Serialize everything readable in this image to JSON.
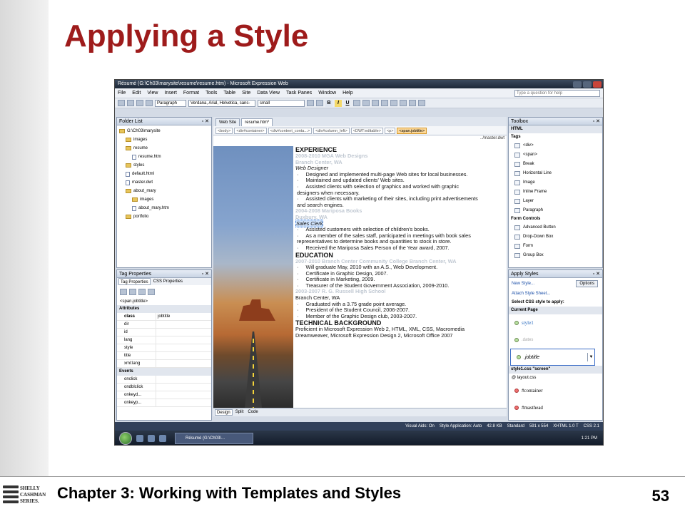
{
  "slide": {
    "title": "Applying a Style",
    "footer": "Chapter 3: Working with Templates and Styles",
    "page_number": "53",
    "logo_text": [
      "SHELLY",
      "CASHMAN",
      "SERIES."
    ]
  },
  "window": {
    "title": "Résumé (G:\\Ch03\\marysite\\resume\\resume.htm) - Microsoft Expression Web",
    "menu": [
      "File",
      "Edit",
      "View",
      "Insert",
      "Format",
      "Tools",
      "Table",
      "Site",
      "Data View",
      "Task Panes",
      "Window",
      "Help"
    ],
    "help_placeholder": "Type a question for help",
    "style_select": "Paragraph",
    "font_select": "Verdana, Arial, Helvetica, sans-",
    "size_select": "small"
  },
  "folder_list": {
    "title": "Folder List",
    "items": [
      {
        "label": "G:\\Ch03\\marysite",
        "type": "folder",
        "indent": 0
      },
      {
        "label": "images",
        "type": "folder",
        "indent": 1
      },
      {
        "label": "resume",
        "type": "folder",
        "indent": 1
      },
      {
        "label": "resume.htm",
        "type": "file",
        "indent": 2
      },
      {
        "label": "styles",
        "type": "folder",
        "indent": 1
      },
      {
        "label": "default.html",
        "type": "file",
        "indent": 1
      },
      {
        "label": "master.dwt",
        "type": "file",
        "indent": 1
      },
      {
        "label": "about_mary",
        "type": "folder",
        "indent": 1
      },
      {
        "label": "images",
        "type": "folder",
        "indent": 2
      },
      {
        "label": "about_mary.htm",
        "type": "file",
        "indent": 2
      },
      {
        "label": "portfolio",
        "type": "folder",
        "indent": 1
      }
    ]
  },
  "tag_properties": {
    "title": "Tag Properties",
    "tabs": [
      "Tag Properties",
      "CSS Properties"
    ],
    "tag": "<span.jobtitle>",
    "attributes_header": "Attributes",
    "attributes": [
      {
        "name": "class",
        "value": "jobtitle"
      },
      {
        "name": "dir",
        "value": ""
      },
      {
        "name": "id",
        "value": ""
      },
      {
        "name": "lang",
        "value": ""
      },
      {
        "name": "style",
        "value": ""
      },
      {
        "name": "title",
        "value": ""
      },
      {
        "name": "xml:lang",
        "value": ""
      }
    ],
    "events_header": "Events",
    "events": [
      "onclick",
      "ondblclick",
      "onkeyd...",
      "onkeyp..."
    ]
  },
  "editor": {
    "tabs": [
      "Web Site",
      "resume.htm*"
    ],
    "crumbs": [
      "<body>",
      "<div#container>",
      "<div#content_conta...>",
      "<div#column_left>",
      "<DWT:editable>",
      "<p>",
      "<span.jobtitle>"
    ],
    "master": "../master.dwt",
    "view_tabs": [
      "Design",
      "Split",
      "Code"
    ],
    "content": [
      {
        "cls": "h",
        "text": "EXPERIENCE"
      },
      {
        "cls": "hdr",
        "text": "2008-2010      MGA Web Designs"
      },
      {
        "cls": "hdr",
        "text": "Branch Center, WA"
      },
      {
        "cls": "it",
        "text": "Web Designer"
      },
      {
        "cls": "b",
        "text": "Designed and implemented multi-page Web sites for local businesses."
      },
      {
        "cls": "b",
        "text": "Maintained and updated clients' Web sites."
      },
      {
        "cls": "b",
        "text": "Assisted clients with selection of graphics and worked with graphic designers when necessary."
      },
      {
        "cls": "b",
        "text": "Assisted clients with marketing of their sites, including print advertisements and search engines."
      },
      {
        "cls": "hdr",
        "text": "2004-2008      Mariposa Books"
      },
      {
        "cls": "hdr",
        "text": "Duxbury, WA"
      },
      {
        "cls": "sel",
        "text": "Sales Clerk"
      },
      {
        "cls": "b",
        "text": "Assisted customers with selection of children's books."
      },
      {
        "cls": "b",
        "text": "As a member of the sales staff, participated in meetings with book sales representatives to determine books and quantities to stock in store."
      },
      {
        "cls": "b",
        "text": "Received the Mariposa Sales Person of the Year award, 2007."
      },
      {
        "cls": "h",
        "text": "EDUCATION"
      },
      {
        "cls": "hdr",
        "text": "2007-2010      Branch Center Community College      Branch Center, WA"
      },
      {
        "cls": "b",
        "text": "Will graduate May, 2010 with an A.S., Web Development."
      },
      {
        "cls": "b",
        "text": "Certificate in Graphic Design, 2007."
      },
      {
        "cls": "b",
        "text": "Certificate in Marketing, 2009."
      },
      {
        "cls": "b",
        "text": "Treasurer of the Student Government Association, 2009-2010."
      },
      {
        "cls": "hdr",
        "text": "2003-2007      R. G. Russell High School"
      },
      {
        "cls": "",
        "text": "Branch Center, WA"
      },
      {
        "cls": "b",
        "text": "Graduated with a 3.75 grade point average."
      },
      {
        "cls": "b",
        "text": "President of the Student Council, 2006-2007."
      },
      {
        "cls": "b",
        "text": "Member of the Graphic Design club, 2003-2007."
      },
      {
        "cls": "h",
        "text": "TECHNICAL BACKGROUND"
      },
      {
        "cls": "",
        "text": "Proficient in Microsoft Expression Web 2, HTML, XML, CSS, Macromedia Dreamweaver, Microsoft Expression Design 2, Microsoft Office 2007"
      }
    ]
  },
  "toolbox": {
    "title": "Toolbox",
    "html_header": "HTML",
    "tags_header": "Tags",
    "tags": [
      "<div>",
      "<span>",
      "Break",
      "Horizontal Line",
      "Image",
      "Inline Frame",
      "Layer",
      "Paragraph"
    ],
    "form_header": "Form Controls",
    "form": [
      "Advanced Button",
      "Drop-Down Box",
      "Form",
      "Group Box"
    ]
  },
  "apply_styles": {
    "title": "Apply Styles",
    "new_style": "New Style...",
    "options": "Options",
    "attach": "Attach Style Sheet...",
    "select_label": "Select CSS style to apply:",
    "current_page": "Current Page",
    "styles": [
      "style1",
      ".dates",
      ".jobtitle"
    ],
    "sheet_header": "style1.css \"screen\"",
    "layout": "@ layout.css",
    "rules": [
      "#container",
      "#masthead"
    ]
  },
  "status": {
    "items": [
      "Visual Aids: On",
      "Style Application: Auto",
      "42.8 KB",
      "Standard",
      "591 x 554",
      "XHTML 1.0 T",
      "CSS 2.1"
    ]
  },
  "taskbar": {
    "task": "Résumé (G:\\Ch03\\...",
    "clock": "1:21 PM"
  }
}
